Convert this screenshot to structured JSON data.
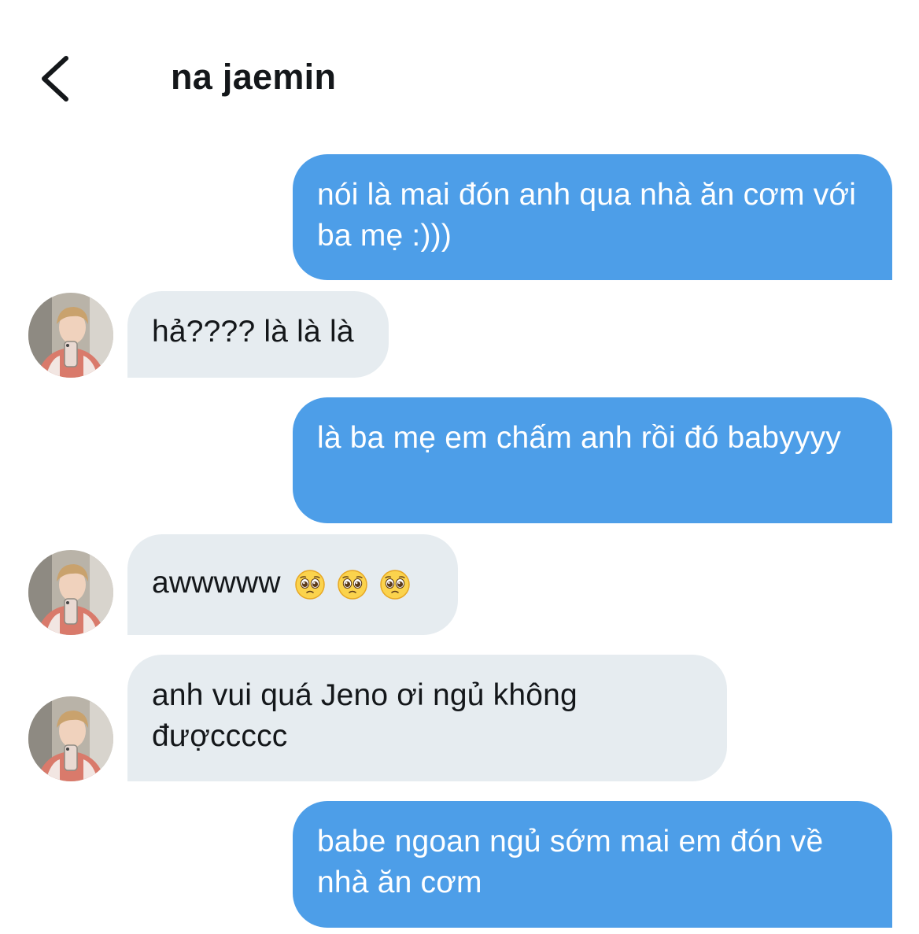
{
  "header": {
    "title": "na jaemin",
    "back_icon": "chevron-left-icon"
  },
  "colors": {
    "outgoing_bubble": "#4d9ee8",
    "incoming_bubble": "#e6ecf0",
    "text_dark": "#14171a"
  },
  "messages": [
    {
      "direction": "outgoing",
      "text": "nói là mai đón anh qua nhà ăn cơm với ba mẹ :)))"
    },
    {
      "direction": "incoming",
      "text": "hả???? là là là",
      "avatar": "avatar-photo"
    },
    {
      "direction": "outgoing",
      "text": "là ba mẹ em chấm anh rồi đó babyyyy"
    },
    {
      "direction": "incoming",
      "text": "awwwww",
      "emojis": [
        "pleading-face-icon",
        "pleading-face-icon",
        "pleading-face-icon"
      ],
      "avatar": "avatar-photo"
    },
    {
      "direction": "incoming",
      "text": "anh vui quá Jeno ơi ngủ không đượccccc",
      "avatar": "avatar-photo"
    },
    {
      "direction": "outgoing",
      "text": "babe ngoan ngủ sớm mai em đón về nhà ăn cơm"
    }
  ]
}
